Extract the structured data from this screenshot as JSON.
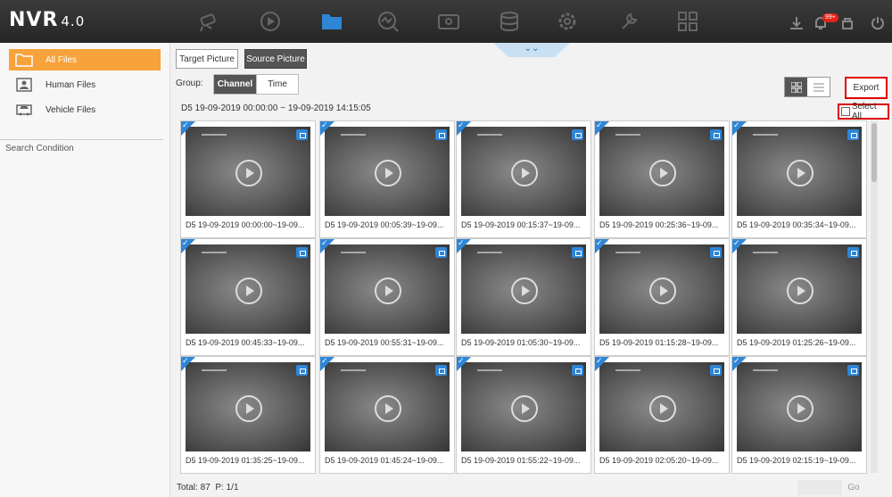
{
  "app": {
    "name": "NVR",
    "version": "4.0"
  },
  "topnav": {
    "icons": [
      "camera-live-icon",
      "playback-icon",
      "file-management-icon",
      "smart-analysis-icon",
      "video-icon",
      "storage-icon",
      "settings-icon",
      "maintenance-icon",
      "multi-view-icon"
    ],
    "active": "file-management-icon",
    "alarm_badge": "99+"
  },
  "sidebar": {
    "items": [
      {
        "label": "All Files",
        "active": true
      },
      {
        "label": "Human Files",
        "active": false
      },
      {
        "label": "Vehicle Files",
        "active": false
      }
    ],
    "search_condition": "Search Condition"
  },
  "toolbar": {
    "target_picture": "Target Picture",
    "source_picture": "Source Picture",
    "group_label": "Group:",
    "group_channel": "Channel",
    "group_time": "Time",
    "export": "Export",
    "select_all": "Select All",
    "range": "D5 19-09-2019 00:00:00 ~ 19-09-2019 14:15:05"
  },
  "files": [
    {
      "caption": "D5 19-09-2019 00:00:00~19-09..."
    },
    {
      "caption": "D5 19-09-2019 00:05:39~19-09..."
    },
    {
      "caption": "D5 19-09-2019 00:15:37~19-09..."
    },
    {
      "caption": "D5 19-09-2019 00:25:36~19-09..."
    },
    {
      "caption": "D5 19-09-2019 00:35:34~19-09..."
    },
    {
      "caption": "D5 19-09-2019 00:45:33~19-09..."
    },
    {
      "caption": "D5 19-09-2019 00:55:31~19-09..."
    },
    {
      "caption": "D5 19-09-2019 01:05:30~19-09..."
    },
    {
      "caption": "D5 19-09-2019 01:15:28~19-09..."
    },
    {
      "caption": "D5 19-09-2019 01:25:26~19-09..."
    },
    {
      "caption": "D5 19-09-2019 01:35:25~19-09..."
    },
    {
      "caption": "D5 19-09-2019 01:45:24~19-09..."
    },
    {
      "caption": "D5 19-09-2019 01:55:22~19-09..."
    },
    {
      "caption": "D5 19-09-2019 02:05:20~19-09..."
    },
    {
      "caption": "D5 19-09-2019 02:15:19~19-09..."
    }
  ],
  "footer": {
    "total": "Total: 87",
    "page": "P: 1/1",
    "go": "Go"
  },
  "colors": {
    "accent": "#f7a23a",
    "select_blue": "#2f86d6",
    "highlight_red": "#dd0000"
  }
}
